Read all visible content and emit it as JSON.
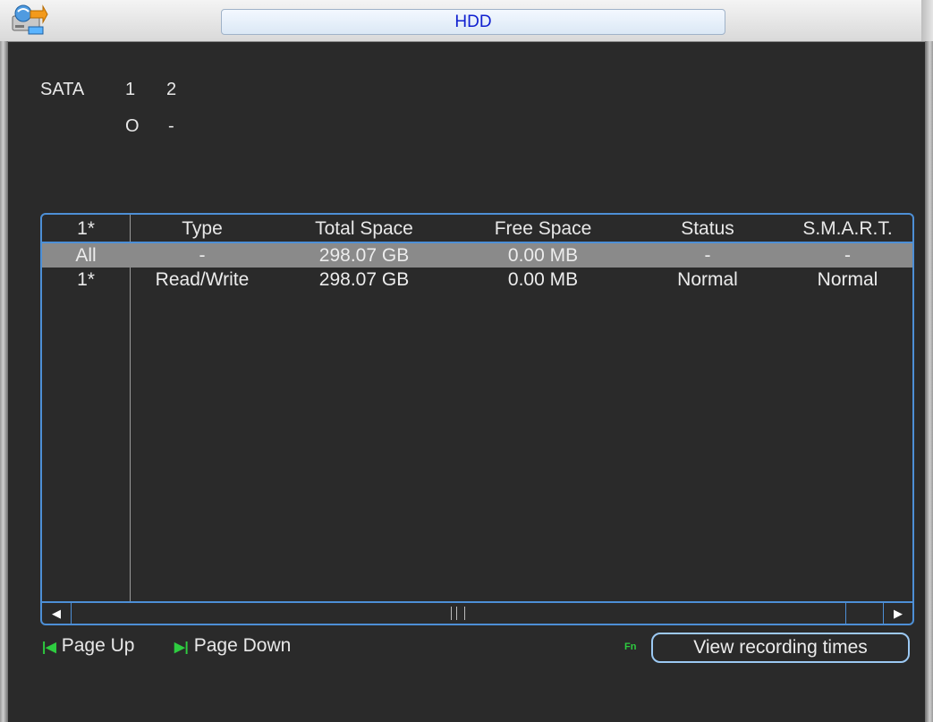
{
  "window": {
    "title": "HDD"
  },
  "sata": {
    "label": "SATA",
    "ports": [
      "1",
      "2"
    ],
    "states": [
      "O",
      "-"
    ]
  },
  "table": {
    "columns": [
      "1*",
      "Type",
      "Total Space",
      "Free Space",
      "Status",
      "S.M.A.R.T."
    ],
    "rows": [
      {
        "disk": "All",
        "type": "-",
        "total": "298.07 GB",
        "free": "0.00 MB",
        "status": "-",
        "smart": "-",
        "selected": true
      },
      {
        "disk": "1*",
        "type": "Read/Write",
        "total": "298.07 GB",
        "free": "0.00 MB",
        "status": "Normal",
        "smart": "Normal",
        "selected": false
      }
    ]
  },
  "footer": {
    "page_up": "Page Up",
    "page_down": "Page Down",
    "fn": "Fn",
    "view_button": "View recording times"
  },
  "colors": {
    "accent_border": "#4d8fd6",
    "title_text": "#1020d0",
    "page_icon": "#2ecc40",
    "selected_row": "#8a8a8a"
  }
}
